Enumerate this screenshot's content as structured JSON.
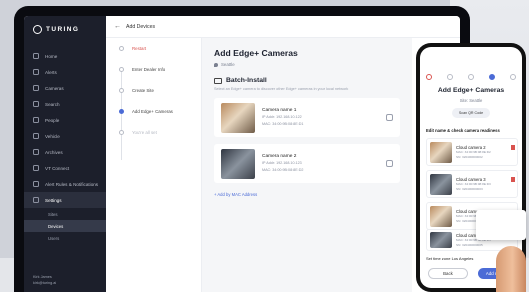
{
  "brand": "TURING",
  "sidebar": {
    "items": [
      {
        "label": "Home",
        "icon": "home-icon"
      },
      {
        "label": "Alerts",
        "icon": "bell-icon"
      },
      {
        "label": "Cameras",
        "icon": "camera-icon"
      },
      {
        "label": "Search",
        "icon": "search-icon"
      },
      {
        "label": "People",
        "icon": "people-icon"
      },
      {
        "label": "Vehicle",
        "icon": "car-icon"
      },
      {
        "label": "Archives",
        "icon": "archive-icon"
      },
      {
        "label": "VT Connect",
        "icon": "link-icon"
      },
      {
        "label": "Alert Rules & Notifications",
        "icon": "rules-icon"
      },
      {
        "label": "Settings",
        "icon": "gear-icon"
      }
    ],
    "sub_items": [
      "Sites",
      "Devices",
      "Users"
    ],
    "user_name": "Kirk James",
    "user_email": "kirk@turing.ai"
  },
  "header": {
    "back": "←",
    "title": "Add Devices"
  },
  "steps": [
    {
      "label": "Restart",
      "state": "err"
    },
    {
      "label": "Enter Dealer Info",
      "state": ""
    },
    {
      "label": "Create Site",
      "state": ""
    },
    {
      "label": "Add Edge+ Cameras",
      "state": "cur"
    },
    {
      "label": "You're all set",
      "state": "dim"
    }
  ],
  "main": {
    "title": "Add Edge+ Cameras",
    "site": "Seattle",
    "section": "Batch-Install",
    "hint": "Select an Edge+ camera to discover other Edge+ cameras in your local network",
    "cameras": [
      {
        "name": "Camera name 1",
        "ip": "IP Addr: 192.168.10.122",
        "mac": "MAC: 34:00:9B:08:8E:D1"
      },
      {
        "name": "Camera name 2",
        "ip": "IP Addr: 192.168.10.123",
        "mac": "MAC: 34:00:9B:08:8E:D2"
      }
    ],
    "add_link": "+ Add by MAC Address"
  },
  "phone": {
    "title": "Add Edge+ Cameras",
    "site": "Site: Seattle",
    "scan": "Scan QR Code",
    "edit": "Edit name & check camera readiness",
    "cards": [
      {
        "name": "Cloud camera 2",
        "mac": "MAC: 34:00:9B:08:8E:D2",
        "sn": "SN: 320400000002"
      },
      {
        "name": "Cloud camera 3",
        "mac": "MAC: 34:00:9B:08:8E:D3",
        "sn": "SN: 320400000003"
      },
      {
        "name": "Cloud camera 4",
        "mac": "MAC: 34:00:9B:08:8E:D4",
        "sn": "SN: 320400000004"
      },
      {
        "name": "Cloud camera 5",
        "mac": "MAC: 34:00:9B:08:8E:D5",
        "sn": "SN: 320400000005"
      }
    ],
    "time": "Set time zone   Los Angeles",
    "back": "Back",
    "next": "Add & Next"
  }
}
